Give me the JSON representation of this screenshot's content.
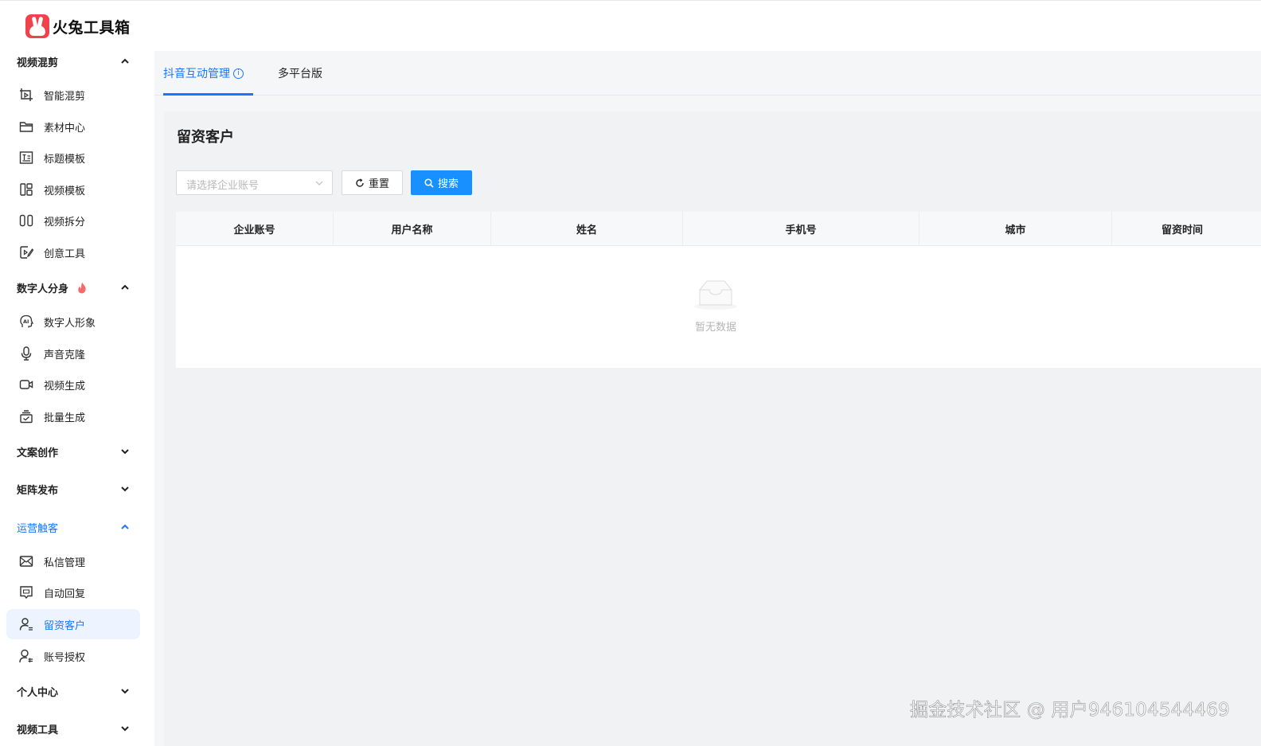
{
  "app": {
    "name": "火兔工具箱"
  },
  "sidebar": {
    "groups": [
      {
        "title": "视频混剪",
        "expanded": true,
        "items": [
          {
            "label": "智能混剪",
            "icon": "smart-edit-icon"
          },
          {
            "label": "素材中心",
            "icon": "folder-icon"
          },
          {
            "label": "标题模板",
            "icon": "title-template-icon"
          },
          {
            "label": "视频模板",
            "icon": "layout-template-icon"
          },
          {
            "label": "视频拆分",
            "icon": "split-icon"
          },
          {
            "label": "创意工具",
            "icon": "creative-tool-icon"
          }
        ]
      },
      {
        "title": "数字人分身",
        "expanded": true,
        "badge_icon": "fire-icon",
        "items": [
          {
            "label": "数字人形象",
            "icon": "ai-avatar-icon"
          },
          {
            "label": "声音克隆",
            "icon": "microphone-icon"
          },
          {
            "label": "视频生成",
            "icon": "video-camera-icon"
          },
          {
            "label": "批量生成",
            "icon": "batch-icon"
          }
        ]
      },
      {
        "title": "文案创作",
        "expanded": false
      },
      {
        "title": "矩阵发布",
        "expanded": false
      },
      {
        "title": "运营触客",
        "expanded": true,
        "active": true,
        "items": [
          {
            "label": "私信管理",
            "icon": "mail-icon"
          },
          {
            "label": "自动回复",
            "icon": "auto-reply-icon"
          },
          {
            "label": "留资客户",
            "icon": "customers-icon",
            "selected": true
          },
          {
            "label": "账号授权",
            "icon": "account-auth-icon"
          }
        ]
      },
      {
        "title": "个人中心",
        "expanded": false
      },
      {
        "title": "视频工具",
        "expanded": false
      }
    ]
  },
  "tabs": [
    {
      "label": "抖音互动管理",
      "active": true,
      "info_icon": "info-icon",
      "info_glyph": "i"
    },
    {
      "label": "多平台版",
      "active": false
    }
  ],
  "page": {
    "title": "留资客户",
    "filter": {
      "placeholder": "请选择企业账号"
    },
    "reset_label": "重置",
    "search_label": "搜索"
  },
  "table": {
    "columns": [
      "企业账号",
      "用户名称",
      "姓名",
      "手机号",
      "城市",
      "留资时间"
    ],
    "rows": [],
    "empty_text": "暂无数据"
  },
  "watermark": "掘金技术社区 @ 用户946104544469",
  "colors": {
    "accent": "#1677ff",
    "search_button": "#1890ff",
    "logo": "#f0424a"
  }
}
